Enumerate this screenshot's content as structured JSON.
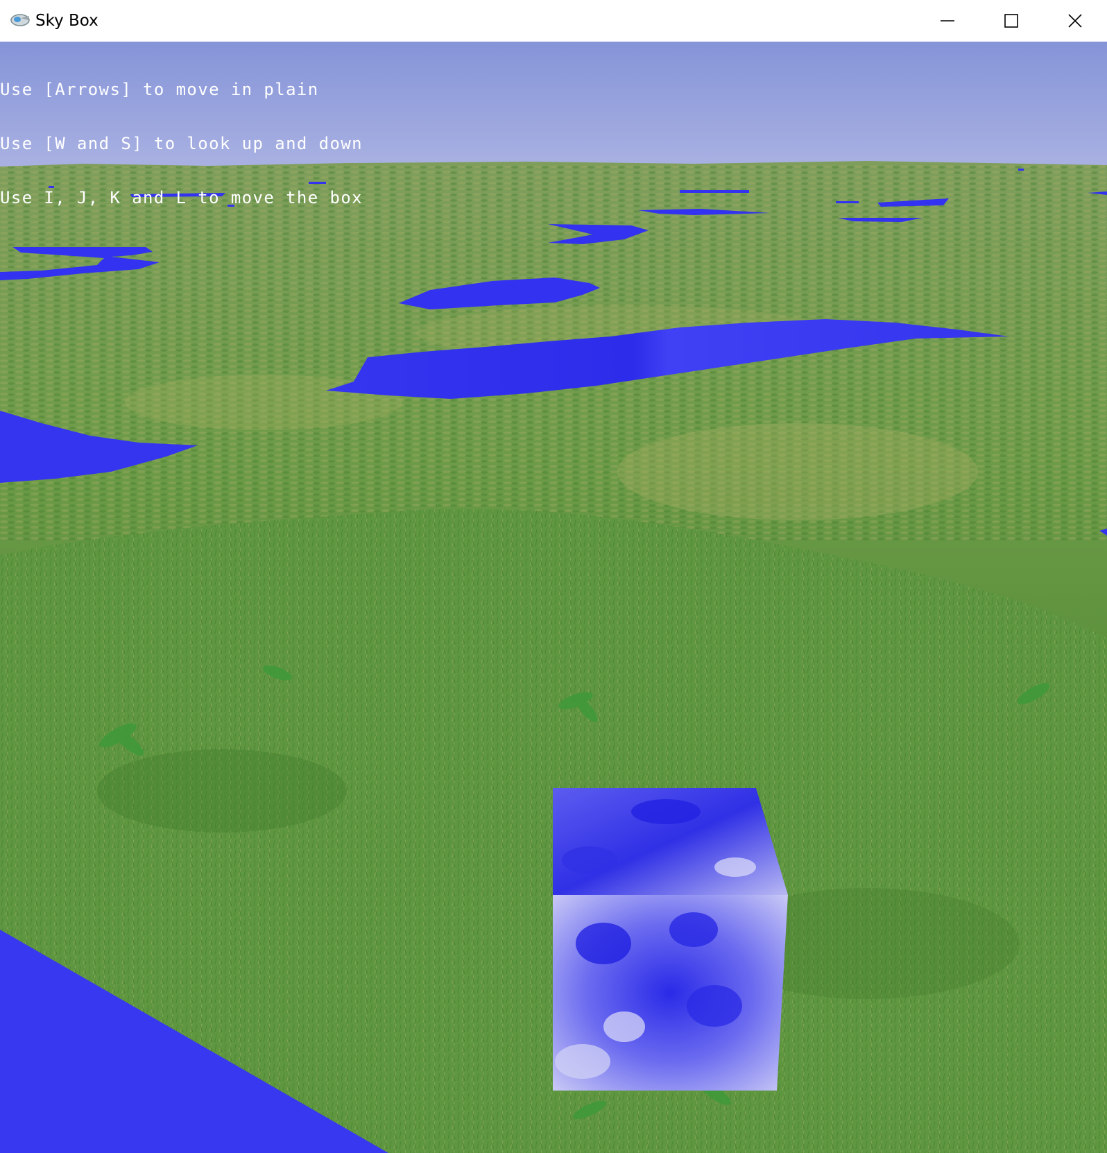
{
  "window": {
    "title": "Sky Box",
    "controls": {
      "minimize_icon": "minimize-icon",
      "maximize_icon": "maximize-icon",
      "close_icon": "close-icon"
    }
  },
  "hud": {
    "lines": [
      "Use [Arrows] to move in plain",
      "Use [W and S] to look up and down",
      "Use I, J, K and L to move the box"
    ]
  },
  "scene": {
    "sky_color": "#9aa6e0",
    "grass_color": "#5f9a3c",
    "water_color": "#3030ee",
    "box_color": "#4444ee"
  }
}
